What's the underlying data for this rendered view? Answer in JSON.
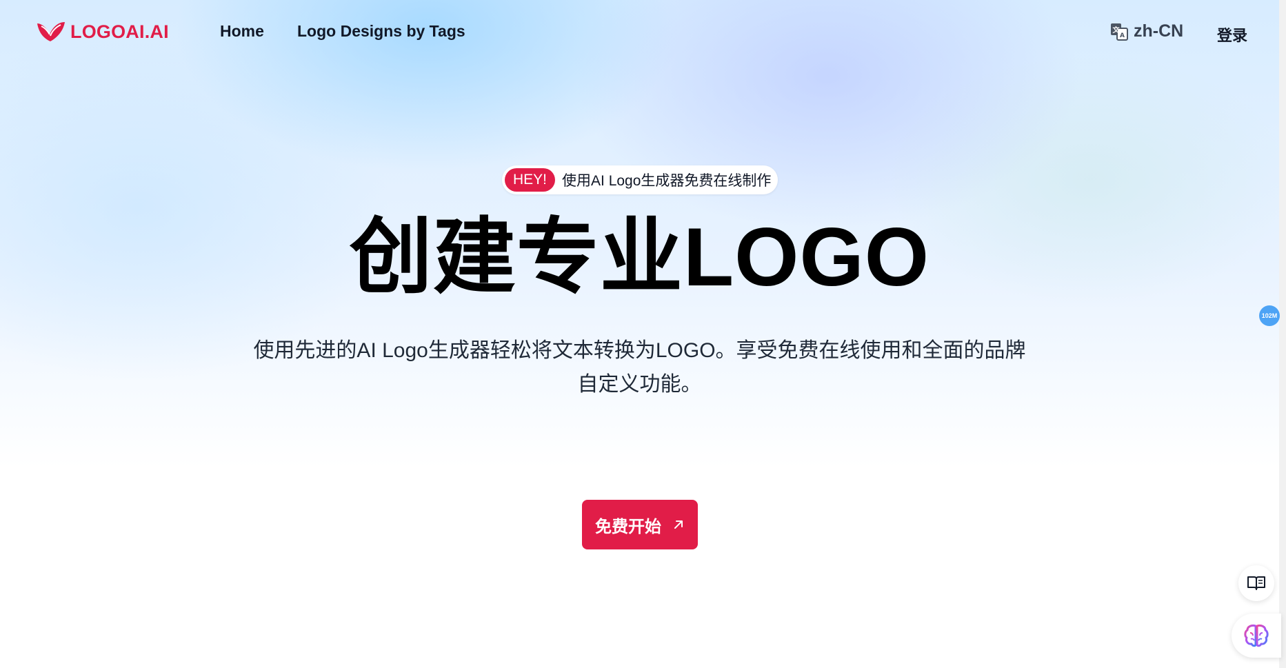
{
  "header": {
    "logo_text": "LOGOAI.AI",
    "nav": [
      {
        "label": "Home"
      },
      {
        "label": "Logo Designs by Tags"
      }
    ],
    "language": "zh-CN",
    "login_label": "登录"
  },
  "hero": {
    "badge_pill": "HEY!",
    "badge_text": "使用AI Logo生成器免费在线制作",
    "title": "创建专业LOGO",
    "subtitle": "使用先进的AI Logo生成器轻松将文本转换为LOGO。享受免费在线使用和全面的品牌自定义功能。",
    "cta_label": "免费开始"
  },
  "widgets": {
    "float_badge": "102M"
  },
  "colors": {
    "brand": "#e11d48",
    "float_badge": "#4da3f5"
  },
  "icons": {
    "logo": "heart-leaf-logo-icon",
    "language": "translate-icon",
    "cta": "arrow-up-right-icon",
    "reader": "book-open-icon",
    "brain": "brain-icon"
  }
}
